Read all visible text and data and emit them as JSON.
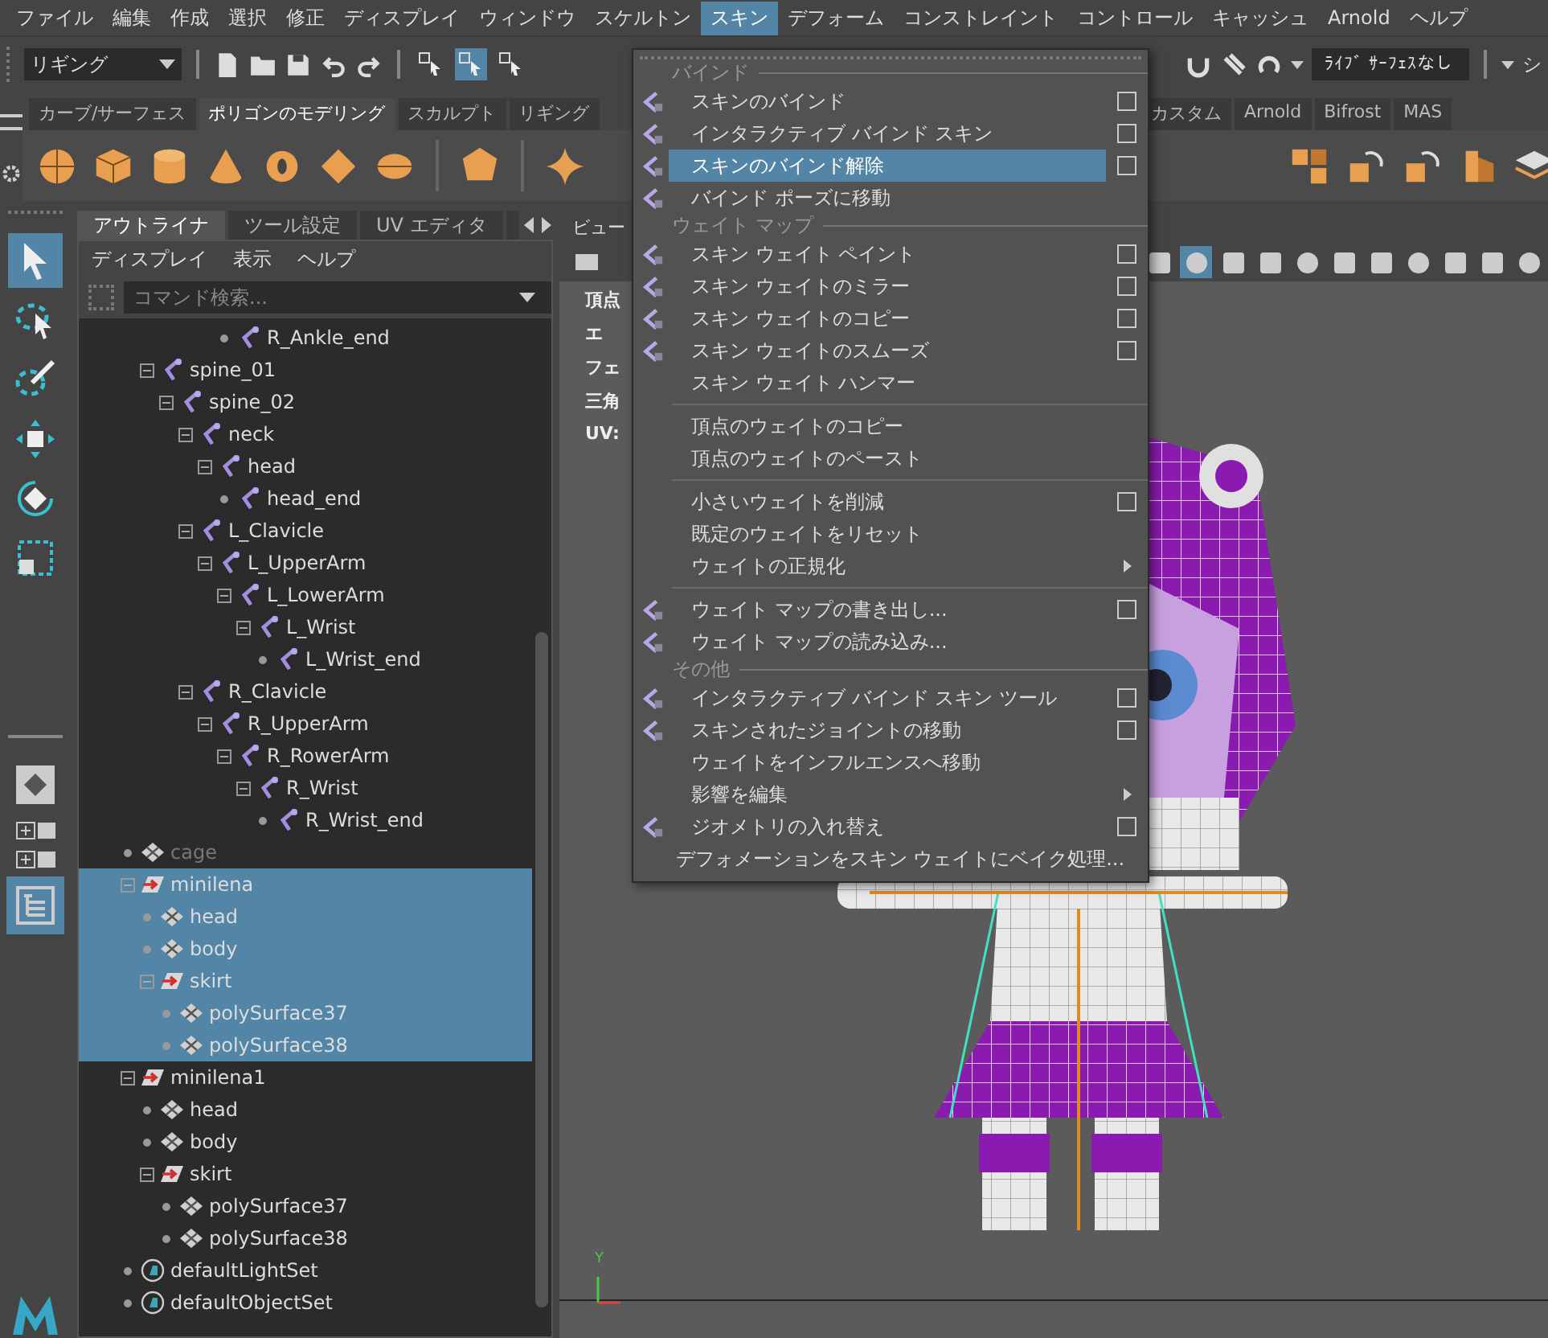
{
  "menubar": [
    {
      "label": "ファイル",
      "selected": false
    },
    {
      "label": "編集",
      "selected": false
    },
    {
      "label": "作成",
      "selected": false
    },
    {
      "label": "選択",
      "selected": false
    },
    {
      "label": "修正",
      "selected": false
    },
    {
      "label": "ディスプレイ",
      "selected": false
    },
    {
      "label": "ウィンドウ",
      "selected": false
    },
    {
      "label": "スケルトン",
      "selected": false
    },
    {
      "label": "スキン",
      "selected": true
    },
    {
      "label": "デフォーム",
      "selected": false
    },
    {
      "label": "コンストレイント",
      "selected": false
    },
    {
      "label": "コントロール",
      "selected": false
    },
    {
      "label": "キャッシュ",
      "selected": false
    },
    {
      "label": "Arnold",
      "selected": false
    },
    {
      "label": "ヘルプ",
      "selected": false
    }
  ],
  "status_line": {
    "workspace": "リギング",
    "select_modes": [
      {
        "selected": false
      },
      {
        "selected": true
      },
      {
        "selected": false
      }
    ],
    "live_surface": "ﾗｲﾌﾞ ｻｰﾌｪｽなし",
    "cut_label": "シ"
  },
  "shelf_tabs": [
    {
      "label": "カーブ/サーフェス",
      "selected": false
    },
    {
      "label": "ポリゴンのモデリング",
      "selected": true
    },
    {
      "label": "スカルプト",
      "selected": false
    },
    {
      "label": "リギング",
      "selected": false
    },
    {
      "label": "カスタム",
      "selected": false
    },
    {
      "label": "Arnold",
      "selected": false
    },
    {
      "label": "Bifrost",
      "selected": false
    },
    {
      "label": "MAS",
      "selected": false
    }
  ],
  "toolbox": [
    {
      "selected": true
    },
    {
      "selected": false
    },
    {
      "selected": false
    },
    {
      "selected": false
    },
    {
      "selected": false
    },
    {
      "selected": false
    }
  ],
  "layout_buttons": [
    {
      "selected": false
    },
    {
      "selected": false
    },
    {
      "selected": false
    },
    {
      "selected": true
    }
  ],
  "outliner": {
    "tabs": [
      {
        "label": "アウトライナ",
        "selected": true
      },
      {
        "label": "ツール設定",
        "selected": false
      },
      {
        "label": "UV エディタ",
        "selected": false
      }
    ],
    "menu": [
      "ディスプレイ",
      "表示",
      "ヘルプ"
    ],
    "search": {
      "placeholder": "コマンド検索..."
    },
    "tree": [
      {
        "children": [
          {
            "children": [
              {
                "children": [
                  {
                    "children": [
                      {
                        "children": [
                          {
                            "label": "R_Ankle_end",
                            "kind": "joint",
                            "selected": false,
                            "hidden": false
                          }
                        ]
                      }
                    ]
                  }
                ]
              }
            ]
          },
          {
            "label": "spine_01",
            "kind": "joint",
            "selected": false,
            "hidden": false,
            "expanded": true,
            "children": [
              {
                "label": "spine_02",
                "kind": "joint",
                "selected": false,
                "hidden": false,
                "expanded": true,
                "children": [
                  {
                    "label": "neck",
                    "kind": "joint",
                    "selected": false,
                    "hidden": false,
                    "expanded": true,
                    "children": [
                      {
                        "label": "head",
                        "kind": "joint",
                        "selected": false,
                        "hidden": false,
                        "expanded": true,
                        "children": [
                          {
                            "label": "head_end",
                            "kind": "joint",
                            "selected": false,
                            "hidden": false
                          }
                        ]
                      }
                    ]
                  },
                  {
                    "label": "L_Clavicle",
                    "kind": "joint",
                    "selected": false,
                    "hidden": false,
                    "expanded": true,
                    "children": [
                      {
                        "label": "L_UpperArm",
                        "kind": "joint",
                        "selected": false,
                        "hidden": false,
                        "expanded": true,
                        "children": [
                          {
                            "label": "L_LowerArm",
                            "kind": "joint",
                            "selected": false,
                            "hidden": false,
                            "expanded": true,
                            "children": [
                              {
                                "label": "L_Wrist",
                                "kind": "joint",
                                "selected": false,
                                "hidden": false,
                                "expanded": true,
                                "children": [
                                  {
                                    "label": "L_Wrist_end",
                                    "kind": "joint",
                                    "selected": false,
                                    "hidden": false
                                  }
                                ]
                              }
                            ]
                          }
                        ]
                      }
                    ]
                  },
                  {
                    "label": "R_Clavicle",
                    "kind": "joint",
                    "selected": false,
                    "hidden": false,
                    "expanded": true,
                    "children": [
                      {
                        "label": "R_UpperArm",
                        "kind": "joint",
                        "selected": false,
                        "hidden": false,
                        "expanded": true,
                        "children": [
                          {
                            "label": "R_RowerArm",
                            "kind": "joint",
                            "selected": false,
                            "hidden": false,
                            "expanded": true,
                            "children": [
                              {
                                "label": "R_Wrist",
                                "kind": "joint",
                                "selected": false,
                                "hidden": false,
                                "expanded": true,
                                "children": [
                                  {
                                    "label": "R_Wrist_end",
                                    "kind": "joint",
                                    "selected": false,
                                    "hidden": false
                                  }
                                ]
                              }
                            ]
                          }
                        ]
                      }
                    ]
                  }
                ]
              }
            ]
          }
        ]
      },
      {
        "label": "cage",
        "kind": "mesh",
        "selected": false,
        "hidden": true
      },
      {
        "label": "minilena",
        "kind": "group",
        "selected": true,
        "hidden": false,
        "expanded": true,
        "children": [
          {
            "label": "head",
            "kind": "mesh",
            "selected": true,
            "hidden": false
          },
          {
            "label": "body",
            "kind": "mesh",
            "selected": true,
            "hidden": false
          },
          {
            "label": "skirt",
            "kind": "group",
            "selected": true,
            "hidden": false,
            "expanded": true,
            "children": [
              {
                "label": "polySurface37",
                "kind": "mesh",
                "selected": true,
                "hidden": false
              },
              {
                "label": "polySurface38",
                "kind": "mesh",
                "selected": true,
                "hidden": false
              }
            ]
          }
        ]
      },
      {
        "label": "minilena1",
        "kind": "group",
        "selected": false,
        "hidden": false,
        "expanded": true,
        "children": [
          {
            "label": "head",
            "kind": "mesh",
            "selected": false,
            "hidden": false
          },
          {
            "label": "body",
            "kind": "mesh",
            "selected": false,
            "hidden": false
          },
          {
            "label": "skirt",
            "kind": "group",
            "selected": false,
            "hidden": false,
            "expanded": true,
            "children": [
              {
                "label": "polySurface37",
                "kind": "mesh",
                "selected": false,
                "hidden": false
              },
              {
                "label": "polySurface38",
                "kind": "mesh",
                "selected": false,
                "hidden": false
              }
            ]
          }
        ]
      },
      {
        "label": "defaultLightSet",
        "kind": "set",
        "selected": false,
        "hidden": false
      },
      {
        "label": "defaultObjectSet",
        "kind": "set",
        "selected": false,
        "hidden": false
      }
    ]
  },
  "viewport": {
    "menu": "ビュー",
    "tools": [
      {
        "selected": false
      },
      {
        "selected": true
      },
      {
        "selected": false
      },
      {
        "selected": false
      },
      {
        "selected": false
      },
      {
        "selected": false
      },
      {
        "selected": false
      },
      {
        "selected": false
      },
      {
        "selected": false
      },
      {
        "selected": false
      },
      {
        "selected": false
      }
    ],
    "hud": [
      "頂点",
      "エ",
      "フェ",
      "三角",
      "UV:"
    ],
    "axis_label": "Y"
  },
  "skin_menu": [
    {
      "kind": "header",
      "label": "バインド"
    },
    {
      "kind": "item",
      "label": "スキンのバインド",
      "icon": true,
      "option": true,
      "submenu": false,
      "selected": false
    },
    {
      "kind": "item",
      "label": "インタラクティブ バインド スキン",
      "icon": true,
      "option": true,
      "submenu": false,
      "selected": false
    },
    {
      "kind": "item",
      "label": "スキンのバインド解除",
      "icon": true,
      "option": true,
      "submenu": false,
      "selected": true
    },
    {
      "kind": "item",
      "label": "バインド ポーズに移動",
      "icon": true,
      "option": false,
      "submenu": false,
      "selected": false
    },
    {
      "kind": "header",
      "label": "ウェイト マップ"
    },
    {
      "kind": "item",
      "label": "スキン ウェイト ペイント",
      "icon": true,
      "option": true,
      "submenu": false,
      "selected": false
    },
    {
      "kind": "item",
      "label": "スキン ウェイトのミラー",
      "icon": true,
      "option": true,
      "submenu": false,
      "selected": false
    },
    {
      "kind": "item",
      "label": "スキン ウェイトのコピー",
      "icon": true,
      "option": true,
      "submenu": false,
      "selected": false
    },
    {
      "kind": "item",
      "label": "スキン ウェイトのスムーズ",
      "icon": true,
      "option": true,
      "submenu": false,
      "selected": false
    },
    {
      "kind": "item",
      "label": "スキン ウェイト ハンマー",
      "icon": false,
      "option": false,
      "submenu": false,
      "selected": false
    },
    {
      "kind": "separator"
    },
    {
      "kind": "item",
      "label": "頂点のウェイトのコピー",
      "icon": false,
      "option": false,
      "submenu": false,
      "selected": false
    },
    {
      "kind": "item",
      "label": "頂点のウェイトのペースト",
      "icon": false,
      "option": false,
      "submenu": false,
      "selected": false
    },
    {
      "kind": "separator"
    },
    {
      "kind": "item",
      "label": "小さいウェイトを削減",
      "icon": false,
      "option": true,
      "submenu": false,
      "selected": false
    },
    {
      "kind": "item",
      "label": "既定のウェイトをリセット",
      "icon": false,
      "option": false,
      "submenu": false,
      "selected": false
    },
    {
      "kind": "item",
      "label": "ウェイトの正規化",
      "icon": false,
      "option": false,
      "submenu": true,
      "selected": false
    },
    {
      "kind": "separator"
    },
    {
      "kind": "item",
      "label": "ウェイト マップの書き出し...",
      "icon": true,
      "option": true,
      "submenu": false,
      "selected": false
    },
    {
      "kind": "item",
      "label": "ウェイト マップの読み込み...",
      "icon": true,
      "option": false,
      "submenu": false,
      "selected": false
    },
    {
      "kind": "header",
      "label": "その他"
    },
    {
      "kind": "item",
      "label": "インタラクティブ バインド スキン ツール",
      "icon": true,
      "option": true,
      "submenu": false,
      "selected": false
    },
    {
      "kind": "item",
      "label": "スキンされたジョイントの移動",
      "icon": true,
      "option": true,
      "submenu": false,
      "selected": false
    },
    {
      "kind": "item",
      "label": "ウェイトをインフルエンスへ移動",
      "icon": false,
      "option": false,
      "submenu": false,
      "selected": false
    },
    {
      "kind": "item",
      "label": "影響を編集",
      "icon": false,
      "option": false,
      "submenu": true,
      "selected": false
    },
    {
      "kind": "item",
      "label": "ジオメトリの入れ替え",
      "icon": true,
      "option": true,
      "submenu": false,
      "selected": false
    },
    {
      "kind": "item",
      "label": "デフォメーションをスキン ウェイトにベイク処理...",
      "icon": false,
      "option": false,
      "submenu": false,
      "selected": false
    }
  ]
}
